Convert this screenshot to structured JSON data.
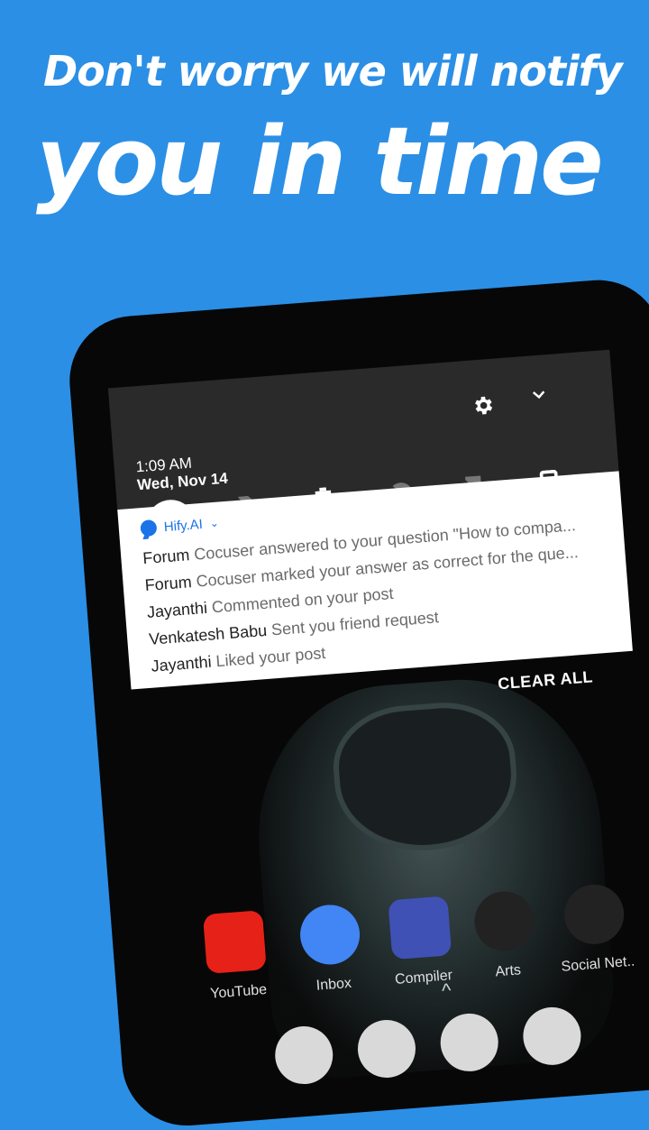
{
  "headline": {
    "line1": "Don't worry we will notify",
    "line2": "you in time"
  },
  "status": {
    "time": "1:09 AM",
    "date": "Wed, Nov 14"
  },
  "quick_settings": [
    "wifi-icon",
    "no-sim-icon",
    "battery-icon",
    "do-not-disturb-icon",
    "flashlight-off-icon",
    "portrait-icon"
  ],
  "notification": {
    "app_name": "Hify.AI",
    "messages": [
      {
        "who": "Forum",
        "text": "Cocuser answered to your question \"How to compa..."
      },
      {
        "who": "Forum",
        "text": "Cocuser marked your answer as correct for the que..."
      },
      {
        "who": "Jayanthi",
        "text": "Commented on your post"
      },
      {
        "who": "Venkatesh Babu",
        "text": "Sent you friend request"
      },
      {
        "who": "Jayanthi",
        "text": "Liked your post"
      }
    ]
  },
  "clear_all": "CLEAR ALL",
  "dock": [
    {
      "label": "YouTube",
      "color": "#e62117"
    },
    {
      "label": "Inbox",
      "color": "#4285f4"
    },
    {
      "label": "Compiler",
      "color": "#3f51b5"
    },
    {
      "label": "Arts",
      "color": "#1769ff"
    },
    {
      "label": "Social Net..",
      "color": "#25d366"
    }
  ],
  "colors": {
    "background": "#2b8fe6",
    "phone": "#070707",
    "accent": "#1a73e8"
  }
}
